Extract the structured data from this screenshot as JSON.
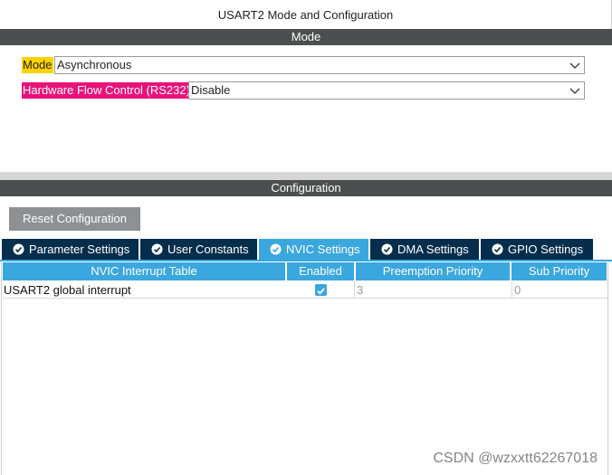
{
  "window": {
    "title": "USART2 Mode and Configuration"
  },
  "mode_section": {
    "header": "Mode",
    "mode_label": "Mode",
    "mode_value": "Asynchronous",
    "mode_label_color": "#ffd200",
    "flow_label": "Hardware Flow Control (RS232)",
    "flow_value": "Disable",
    "flow_label_color": "#e8137a"
  },
  "config_section": {
    "header": "Configuration",
    "reset_button": "Reset Configuration",
    "tabs": [
      {
        "label": "Parameter Settings",
        "active": false
      },
      {
        "label": "User Constants",
        "active": false
      },
      {
        "label": "NVIC Settings",
        "active": true
      },
      {
        "label": "DMA Settings",
        "active": false
      },
      {
        "label": "GPIO Settings",
        "active": false
      }
    ],
    "table": {
      "headers": [
        "NVIC Interrupt Table",
        "Enabled",
        "Preemption Priority",
        "Sub Priority"
      ],
      "rows": [
        {
          "name": "USART2 global interrupt",
          "enabled": true,
          "preemption": "3",
          "sub": "0"
        }
      ]
    }
  },
  "watermark": "CSDN @wzxxtt62267018",
  "colors": {
    "accent": "#3aa7de",
    "tab_dark": "#052e4d",
    "bar": "#4c4f50"
  }
}
